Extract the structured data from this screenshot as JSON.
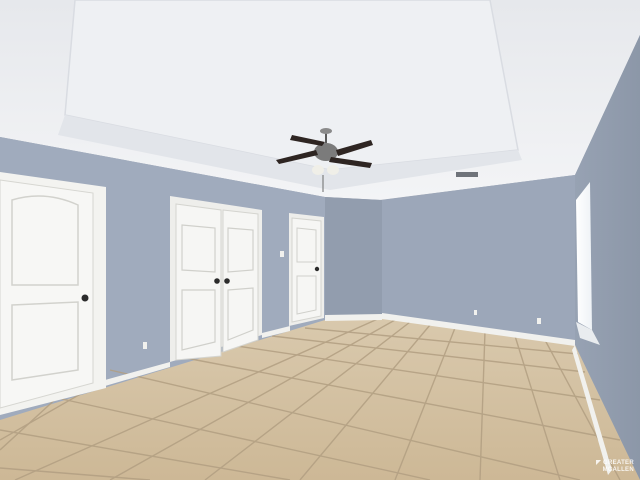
{
  "photo": {
    "subject": "empty-bedroom-interior",
    "colors": {
      "ceiling": "#eceef1",
      "wall_blue": "#9ea9bb",
      "wall_blue_shadow": "#8d98aa",
      "door_white": "#f4f4f2",
      "floor_tile": "#d6c3a4",
      "grout": "#b7a58a",
      "trim": "#f2f2f0"
    }
  },
  "watermark": {
    "text": "GREATER MCALLEN",
    "icon": "realtor-logo-icon"
  }
}
